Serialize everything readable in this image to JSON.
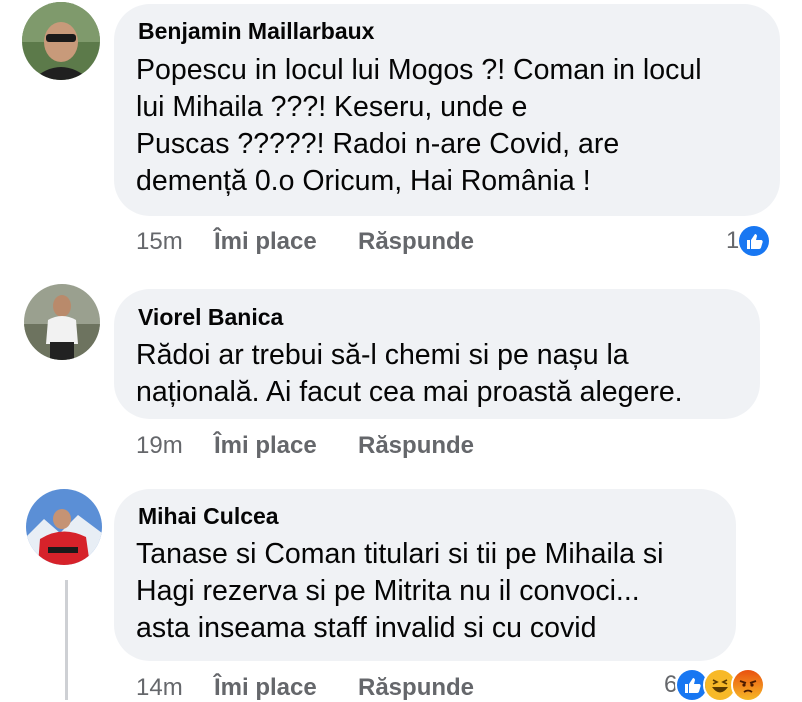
{
  "comments": [
    {
      "author": "Benjamin Maillarbaux",
      "text": "Popescu in locul lui Mogos ?! Coman in locul\nlui Mihaila ???! Keseru, unde e\nPuscas ?????! Radoi n-are Covid, are\ndemență 0.o Oricum, Hai România !",
      "time": "15m",
      "like_label": "Îmi place",
      "reply_label": "Răspunde",
      "reaction_count": "1",
      "reactions": [
        "like-icon"
      ]
    },
    {
      "author": "Viorel Banica",
      "text": "Rădoi ar trebui să-l chemi si pe nașu la\nnațională. Ai facut cea mai proastă alegere.",
      "time": "19m",
      "like_label": "Îmi place",
      "reply_label": "Răspunde"
    },
    {
      "author": "Mihai Culcea",
      "text": "Tanase si Coman titulari si tii pe Mihaila si\nHagi rezerva si pe Mitrita nu il convoci...\nasta inseama staff invalid si cu covid",
      "time": "14m",
      "like_label": "Îmi place",
      "reply_label": "Răspunde",
      "reaction_count": "6",
      "reactions": [
        "like-icon",
        "haha-icon",
        "angry-icon"
      ]
    }
  ],
  "colors": {
    "bubble": "#f0f2f5",
    "meta_text": "#65676b",
    "like_blue": "#1877f2",
    "haha_yellow": "#f7b928",
    "angry_orange": "#e9710f"
  }
}
